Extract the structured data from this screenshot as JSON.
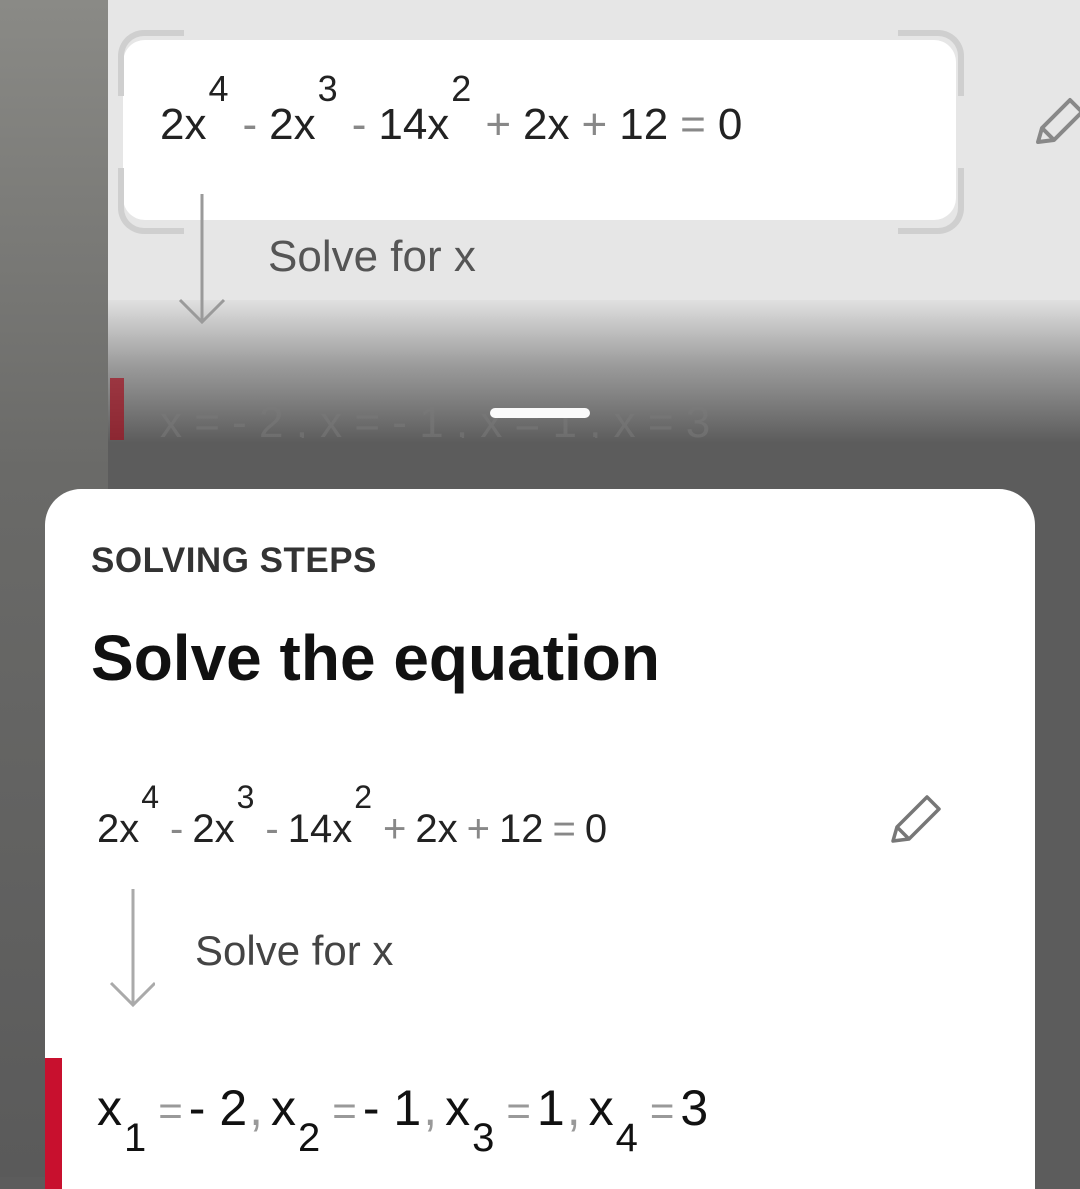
{
  "background": {
    "equation": {
      "terms": [
        {
          "coef": "2x",
          "exp": "4"
        },
        {
          "op": "-",
          "coef": "2x",
          "exp": "3"
        },
        {
          "op": "-",
          "coef": "14x",
          "exp": "2"
        },
        {
          "op": "+",
          "coef": "2x"
        },
        {
          "op": "+",
          "coef": "12"
        },
        {
          "op": "=",
          "coef": "0"
        }
      ]
    },
    "solve_label": "Solve for x",
    "partial_result": "x = - 2 , x = - 1 , x = 1 , x = 3"
  },
  "sheet": {
    "section_label": "SOLVING STEPS",
    "title": "Solve the equation",
    "equation": {
      "terms": [
        {
          "coef": "2x",
          "exp": "4"
        },
        {
          "op": "-",
          "coef": "2x",
          "exp": "3"
        },
        {
          "op": "-",
          "coef": "14x",
          "exp": "2"
        },
        {
          "op": "+",
          "coef": "2x"
        },
        {
          "op": "+",
          "coef": "12"
        },
        {
          "op": "=",
          "coef": "0"
        }
      ]
    },
    "solve_label": "Solve for x",
    "result": [
      {
        "var": "x",
        "sub": "1",
        "value": "- 2"
      },
      {
        "var": "x",
        "sub": "2",
        "value": "- 1"
      },
      {
        "var": "x",
        "sub": "3",
        "value": "1"
      },
      {
        "var": "x",
        "sub": "4",
        "value": "3"
      }
    ]
  },
  "colors": {
    "accent": "#c8102e"
  },
  "icons": [
    "pencil-icon",
    "down-arrow-icon"
  ]
}
